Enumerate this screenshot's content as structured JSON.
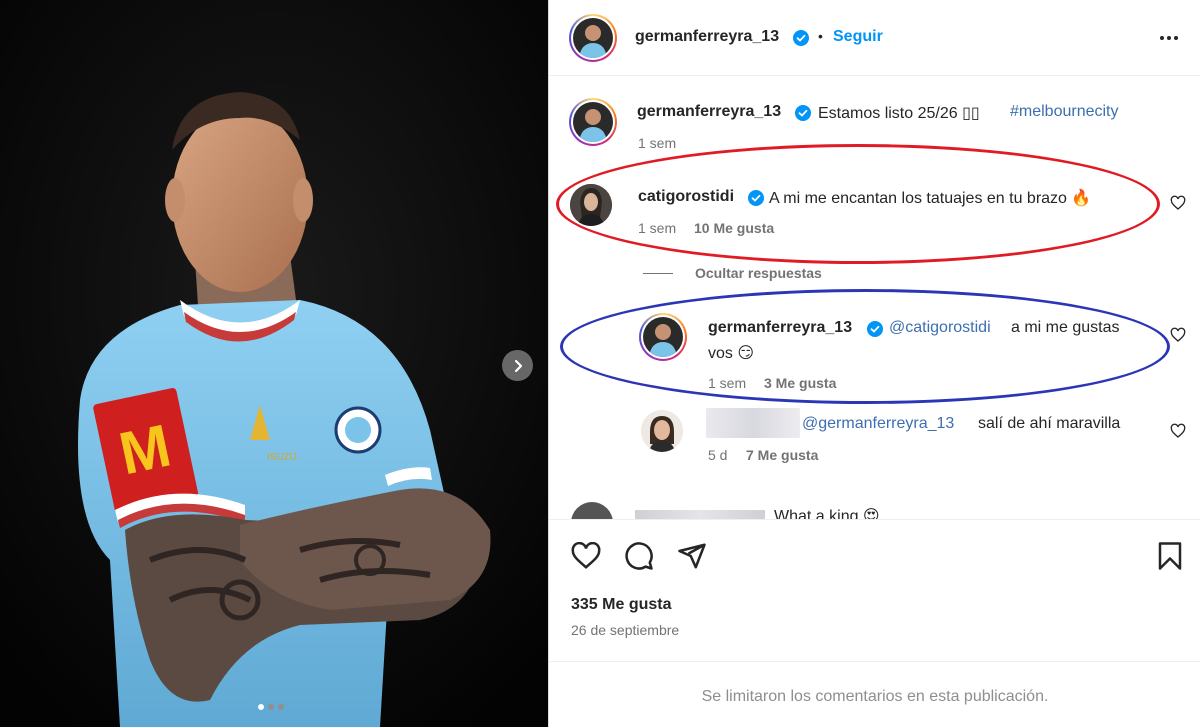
{
  "post": {
    "image_dots": 3,
    "active_dot": 0
  },
  "header": {
    "username": "germanferreyra_13",
    "separator": "•",
    "follow_label": "Seguir",
    "more_icon": "more-horizontal-icon"
  },
  "caption": {
    "username": "germanferreyra_13",
    "text": "Estamos listo 25/26 ▯▯",
    "hashtag": "#melbournecity",
    "time": "1 sem"
  },
  "comments": [
    {
      "username": "catigorostidi",
      "text": "A mi me encantan los tatuajes en tu brazo 🔥",
      "time": "1 sem",
      "likes": "10 Me gusta"
    }
  ],
  "hide_replies_label": "Ocultar respuestas",
  "replies": [
    {
      "username": "germanferreyra_13",
      "mention": "@catigorostidi",
      "text_line1": "a mi me gustas",
      "text_line2": "vos 😏",
      "time": "1 sem",
      "likes": "3 Me gusta"
    },
    {
      "mention": "@germanferreyra_13",
      "text": "salí de ahí maravilla",
      "time": "5 d",
      "likes": "7 Me gusta"
    }
  ],
  "partial_comment": {
    "text": "What a king 😍"
  },
  "actions": {
    "likes": "335 Me gusta",
    "date": "26 de septiembre"
  },
  "footer_note": "Se limitaron los comentarios en esta publicación.",
  "colors": {
    "accent_blue": "#0095f6",
    "verified_blue": "#0095f6",
    "annotation_red": "#e01b24",
    "annotation_blue": "#2b35b5",
    "jersey_sky": "#7cc3ea"
  }
}
